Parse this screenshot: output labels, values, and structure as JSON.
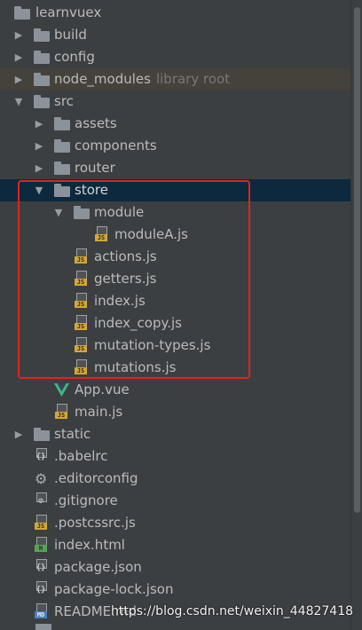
{
  "tree": [
    {
      "name": "learnvuex"
    },
    {
      "name": "build"
    },
    {
      "name": "config"
    },
    {
      "name": "node_modules",
      "hint": "library root"
    },
    {
      "name": "src"
    },
    {
      "name": "assets"
    },
    {
      "name": "components"
    },
    {
      "name": "router"
    },
    {
      "name": "store"
    },
    {
      "name": "module"
    },
    {
      "name": "moduleA.js",
      "icon": "JS"
    },
    {
      "name": "actions.js",
      "icon": "JS"
    },
    {
      "name": "getters.js",
      "icon": "JS"
    },
    {
      "name": "index.js",
      "icon": "JS"
    },
    {
      "name": "index_copy.js",
      "icon": "JS"
    },
    {
      "name": "mutation-types.js",
      "icon": "JS"
    },
    {
      "name": "mutations.js",
      "icon": "JS"
    },
    {
      "name": "App.vue"
    },
    {
      "name": "main.js",
      "icon": "JS"
    },
    {
      "name": "static"
    },
    {
      "name": ".babelrc"
    },
    {
      "name": ".editorconfig"
    },
    {
      "name": ".gitignore"
    },
    {
      "name": ".postcssrc.js",
      "icon": "JS"
    },
    {
      "name": "index.html",
      "icon": "H"
    },
    {
      "name": "package.json"
    },
    {
      "name": "package-lock.json"
    },
    {
      "name": "README.md",
      "icon": "MD"
    }
  ],
  "watermark": "https://blog.csdn.net/weixin_44827418",
  "colors": {
    "background": "#3c3f41",
    "selection": "#0d293e",
    "highlight_border": "#e0241b",
    "js_badge": "#d5a734",
    "vue_green": "#41b883"
  }
}
